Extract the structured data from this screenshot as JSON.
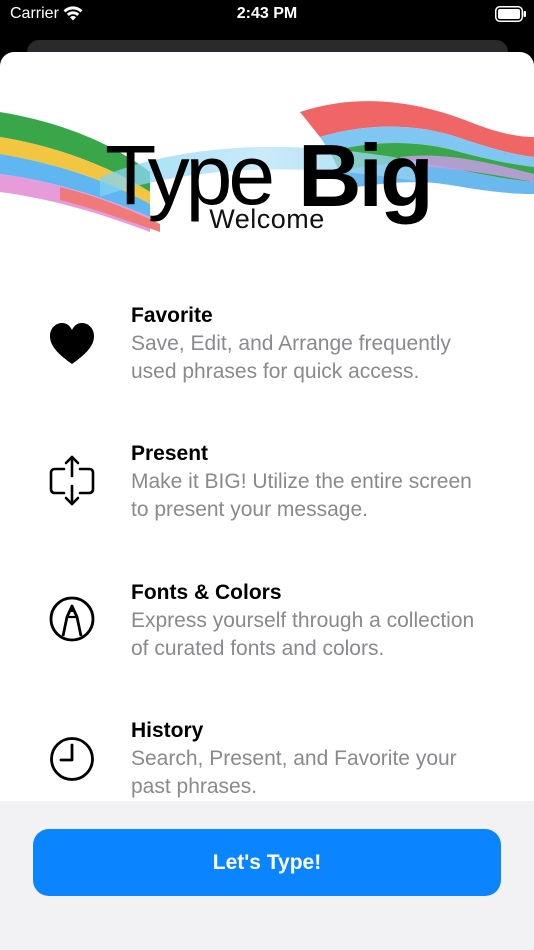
{
  "status_bar": {
    "carrier": "Carrier",
    "time": "2:43 PM"
  },
  "hero": {
    "logo_word_1": "Type",
    "logo_word_2": "Big",
    "welcome": "Welcome"
  },
  "features": [
    {
      "title": "Favorite",
      "desc_line_1": "Save, Edit, and Arrange frequently",
      "desc_line_2": "used phrases for quick access.",
      "icon": "heart-icon"
    },
    {
      "title": "Present",
      "desc_line_1": "Make it BIG! Utilize the entire screen",
      "desc_line_2": "to present your message.",
      "icon": "present-expand-icon"
    },
    {
      "title": "Fonts & Colors",
      "desc_line_1": "Express yourself through a collection",
      "desc_line_2": "of curated fonts and colors.",
      "icon": "marker-pen-icon"
    },
    {
      "title": "History",
      "desc_line_1": "Search, Present, and Favorite your",
      "desc_line_2": "past phrases.",
      "icon": "clock-icon"
    }
  ],
  "cta": {
    "label": "Let's Type!"
  },
  "colors": {
    "accent": "#0a84ff",
    "secondary_text": "#8a8a8e"
  }
}
